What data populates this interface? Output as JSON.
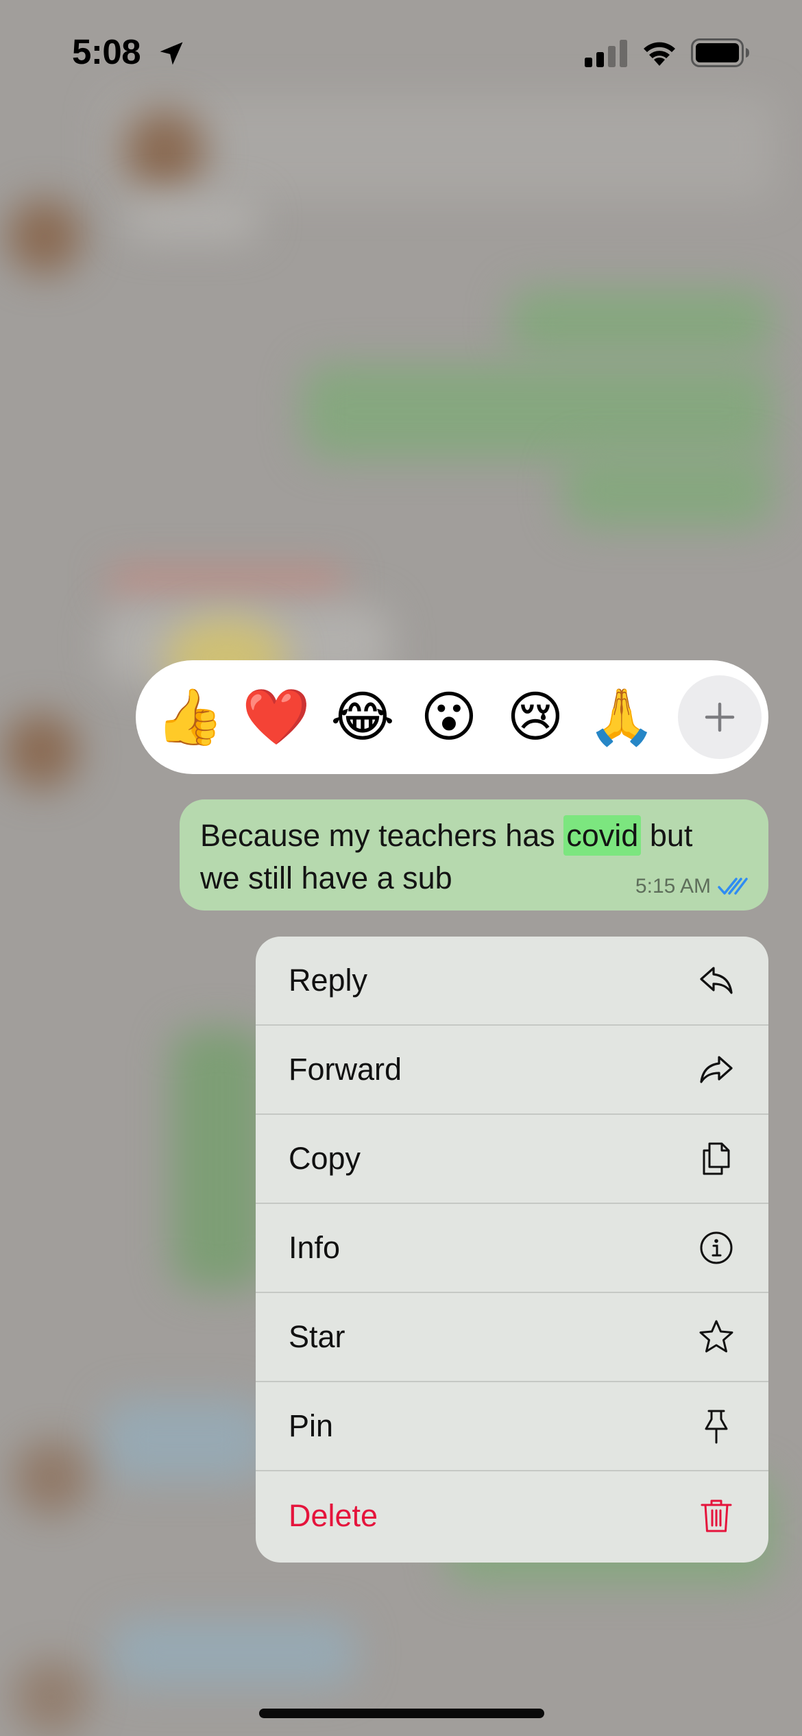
{
  "status_bar": {
    "time": "5:08",
    "icons": [
      "location-arrow-icon",
      "cellular-signal-icon",
      "wifi-icon",
      "battery-icon"
    ]
  },
  "reactions": {
    "items": [
      {
        "name": "thumbs-up",
        "emoji": "👍"
      },
      {
        "name": "red-heart",
        "emoji": "❤️"
      },
      {
        "name": "face-with-tears-of-joy",
        "emoji": "😂"
      },
      {
        "name": "face-with-open-mouth",
        "emoji": "😮"
      },
      {
        "name": "crying-face",
        "emoji": "😢"
      },
      {
        "name": "folded-hands",
        "emoji": "🙏"
      }
    ],
    "more_icon": "plus-icon"
  },
  "message": {
    "text_before": "Because my teachers has ",
    "highlight": "covid",
    "text_after": " but we still have a sub",
    "time": "5:15 AM",
    "status_icon": "double-check-icon",
    "bubble_color": "#b6d9ae",
    "highlight_color": "#7ce67f",
    "check_color": "#2f8cf2"
  },
  "menu": {
    "items": [
      {
        "label": "Reply",
        "icon": "reply-icon"
      },
      {
        "label": "Forward",
        "icon": "forward-icon"
      },
      {
        "label": "Copy",
        "icon": "copy-icon"
      },
      {
        "label": "Info",
        "icon": "info-icon"
      },
      {
        "label": "Star",
        "icon": "star-icon"
      },
      {
        "label": "Pin",
        "icon": "pin-icon"
      },
      {
        "label": "Delete",
        "icon": "trash-icon",
        "destructive": true
      }
    ],
    "destructive_color": "#e5143c"
  }
}
